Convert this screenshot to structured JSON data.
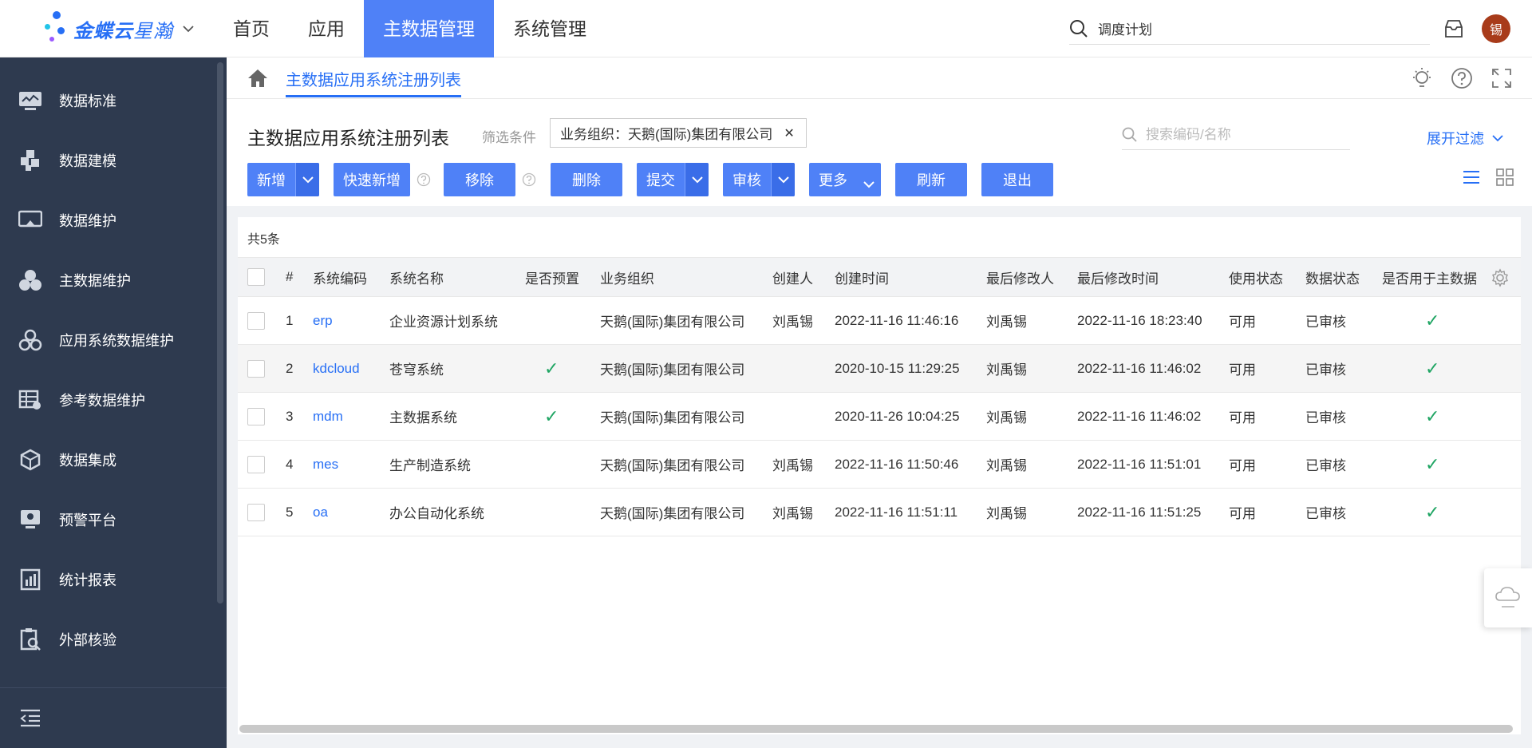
{
  "brand": {
    "name_bold": "金蝶云",
    "name_light": "星瀚"
  },
  "topnav": {
    "items": [
      {
        "label": "首页"
      },
      {
        "label": "应用"
      },
      {
        "label": "主数据管理"
      },
      {
        "label": "系统管理"
      }
    ]
  },
  "top_search": {
    "value": "调度计划"
  },
  "user": {
    "avatar_text": "锡"
  },
  "sidebar": {
    "items": [
      {
        "label": "数据标准",
        "icon": "chart-monitor-icon"
      },
      {
        "label": "数据建模",
        "icon": "blocks-icon"
      },
      {
        "label": "数据维护",
        "icon": "monitor-icon"
      },
      {
        "label": "主数据维护",
        "icon": "cluster-icon"
      },
      {
        "label": "应用系统数据维护",
        "icon": "gear-cluster-icon"
      },
      {
        "label": "参考数据维护",
        "icon": "table-gear-icon"
      },
      {
        "label": "数据集成",
        "icon": "cube-icon"
      },
      {
        "label": "预警平台",
        "icon": "alert-screen-icon"
      },
      {
        "label": "统计报表",
        "icon": "report-icon"
      },
      {
        "label": "外部核验",
        "icon": "clipboard-search-icon"
      }
    ]
  },
  "breadcrumb": {
    "tab": "主数据应用系统注册列表"
  },
  "page": {
    "title": "主数据应用系统注册列表",
    "filter_label": "筛选条件",
    "filter_tag": "业务组织：天鹅(国际)集团有限公司",
    "search_placeholder": "搜索编码/名称",
    "expand_filter": "展开过滤"
  },
  "toolbar": {
    "add": "新增",
    "quick_add": "快速新增",
    "remove": "移除",
    "delete": "删除",
    "submit": "提交",
    "audit": "审核",
    "more": "更多",
    "refresh": "刷新",
    "exit": "退出"
  },
  "table": {
    "total": "共5条",
    "headers": {
      "index": "#",
      "code": "系统编码",
      "name": "系统名称",
      "preset": "是否预置",
      "org": "业务组织",
      "creator": "创建人",
      "created": "创建时间",
      "modifier": "最后修改人",
      "modified": "最后修改时间",
      "use_status": "使用状态",
      "data_status": "数据状态",
      "for_master": "是否用于主数据"
    },
    "rows": [
      {
        "index": "1",
        "code": "erp",
        "name": "企业资源计划系统",
        "preset": false,
        "org": "天鹅(国际)集团有限公司",
        "creator": "刘禹锡",
        "created": "2022-11-16 11:46:16",
        "modifier": "刘禹锡",
        "modified": "2022-11-16 18:23:40",
        "use_status": "可用",
        "data_status": "已审核",
        "for_master": true
      },
      {
        "index": "2",
        "code": "kdcloud",
        "name": "苍穹系统",
        "preset": true,
        "org": "天鹅(国际)集团有限公司",
        "creator": "",
        "created": "2020-10-15 11:29:25",
        "modifier": "刘禹锡",
        "modified": "2022-11-16 11:46:02",
        "use_status": "可用",
        "data_status": "已审核",
        "for_master": true
      },
      {
        "index": "3",
        "code": "mdm",
        "name": "主数据系统",
        "preset": true,
        "org": "天鹅(国际)集团有限公司",
        "creator": "",
        "created": "2020-11-26 10:04:25",
        "modifier": "刘禹锡",
        "modified": "2022-11-16 11:46:02",
        "use_status": "可用",
        "data_status": "已审核",
        "for_master": true
      },
      {
        "index": "4",
        "code": "mes",
        "name": "生产制造系统",
        "preset": false,
        "org": "天鹅(国际)集团有限公司",
        "creator": "刘禹锡",
        "created": "2022-11-16 11:50:46",
        "modifier": "刘禹锡",
        "modified": "2022-11-16 11:51:01",
        "use_status": "可用",
        "data_status": "已审核",
        "for_master": true
      },
      {
        "index": "5",
        "code": "oa",
        "name": "办公自动化系统",
        "preset": false,
        "org": "天鹅(国际)集团有限公司",
        "creator": "刘禹锡",
        "created": "2022-11-16 11:51:11",
        "modifier": "刘禹锡",
        "modified": "2022-11-16 11:51:25",
        "use_status": "可用",
        "data_status": "已审核",
        "for_master": true
      }
    ]
  },
  "colors": {
    "accent": "#4f81f7",
    "sidebar_bg": "#2e3a4f",
    "link": "#276ff5",
    "check": "#1fa563"
  }
}
